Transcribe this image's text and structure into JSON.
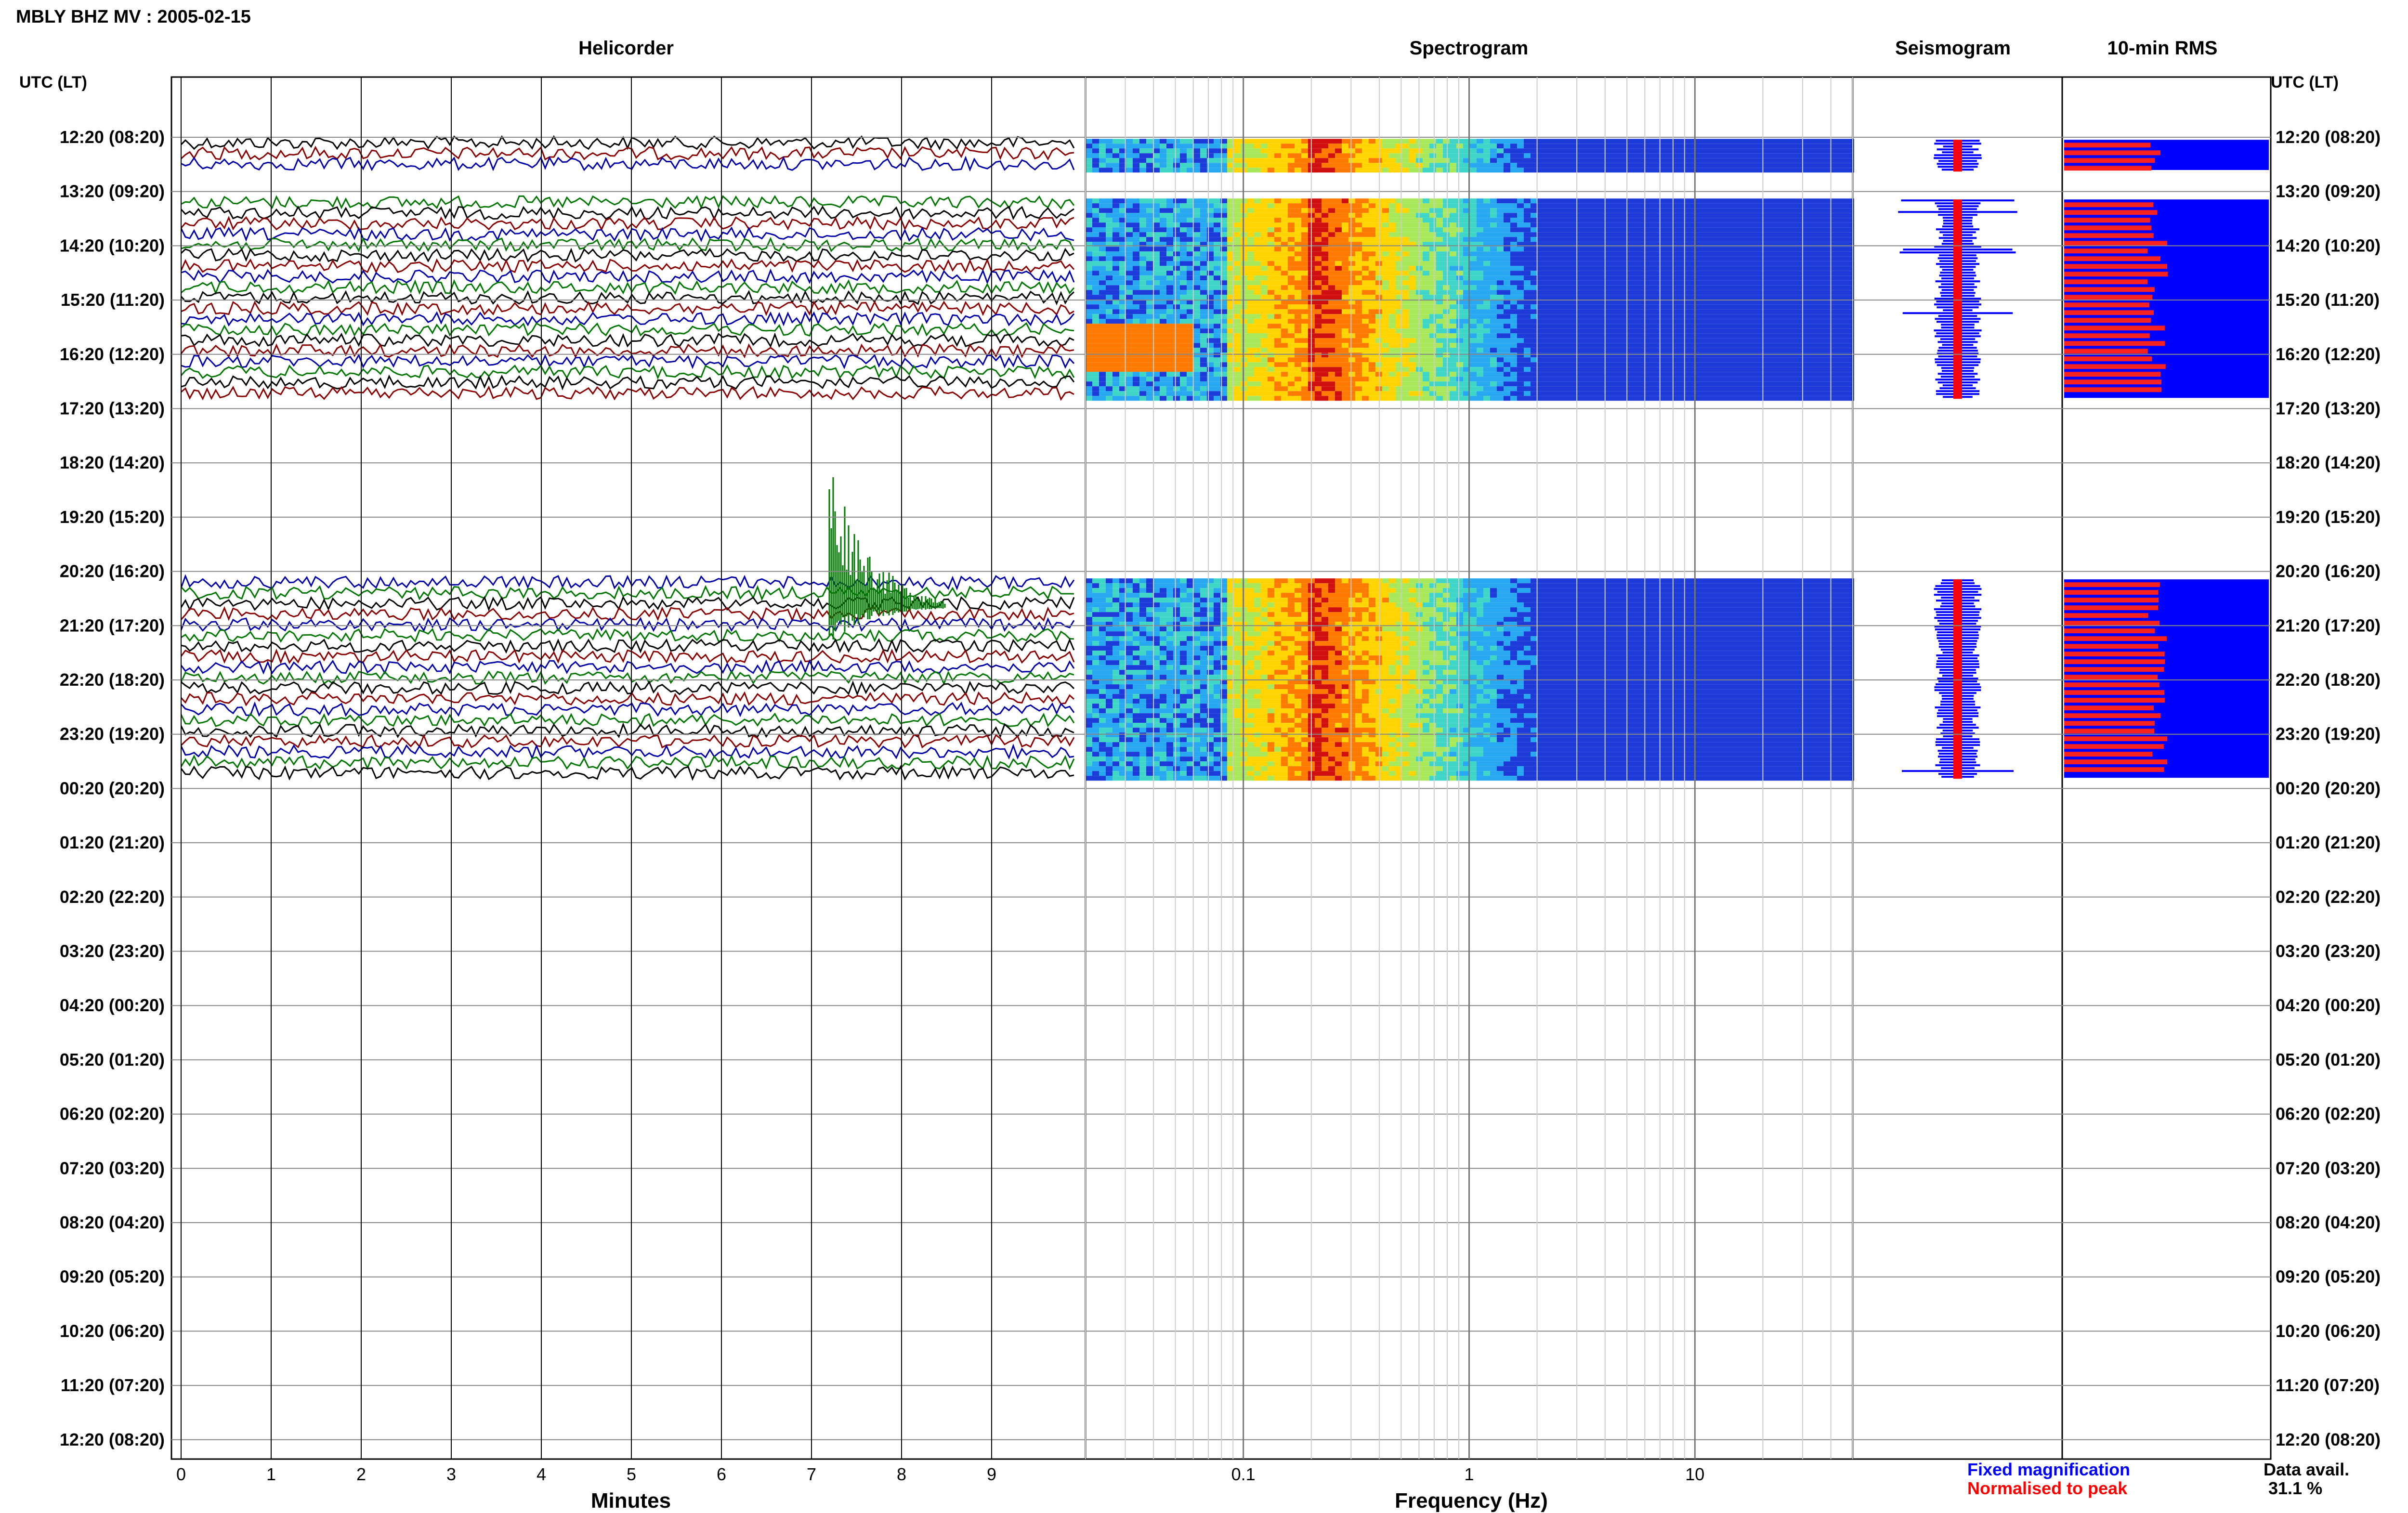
{
  "header": {
    "title": "MBLY BHZ MV : 2005-02-15"
  },
  "panels": {
    "helicorder": "Helicorder",
    "spectrogram": "Spectrogram",
    "seismogram": "Seismogram",
    "rms": "10-min RMS"
  },
  "axes": {
    "time_header_left": "UTC (LT)",
    "time_header_right": "UTC (LT)",
    "time_labels": [
      "12:20 (08:20)",
      "13:20 (09:20)",
      "14:20 (10:20)",
      "15:20 (11:20)",
      "16:20 (12:20)",
      "17:20 (13:20)",
      "18:20 (14:20)",
      "19:20 (15:20)",
      "20:20 (16:20)",
      "21:20 (17:20)",
      "22:20 (18:20)",
      "23:20 (19:20)",
      "00:20 (20:20)",
      "01:20 (21:20)",
      "02:20 (22:20)",
      "03:20 (23:20)",
      "04:20 (00:20)",
      "05:20 (01:20)",
      "06:20 (02:20)",
      "07:20 (03:20)",
      "08:20 (04:20)",
      "09:20 (05:20)",
      "10:20 (06:20)",
      "11:20 (07:20)",
      "12:20 (08:20)"
    ],
    "minutes_label": "Minutes",
    "minutes_ticks": [
      "0",
      "1",
      "2",
      "3",
      "4",
      "5",
      "6",
      "7",
      "8",
      "9"
    ],
    "frequency_label": "Frequency (Hz)",
    "frequency_ticks": [
      "0.1",
      "1",
      "10"
    ]
  },
  "legend": {
    "fixed": "Fixed magnification",
    "normalised": "Normalised to peak",
    "fixed_color": "#0000ff",
    "normalised_color": "#ff0000"
  },
  "availability": {
    "label": "Data avail.",
    "value": "31.1 %"
  },
  "chart_data": {
    "type": "helicorder",
    "rows_hours": 24,
    "data_blocks_hours": [
      [
        0.1,
        0.55
      ],
      [
        1.2,
        4.75
      ],
      [
        8.2,
        11.75
      ]
    ],
    "event": {
      "hour": 8.3,
      "minute_start": 7.2,
      "minute_end": 8.5
    },
    "trace_colors": [
      "#000000",
      "#8b0000",
      "#0000aa",
      "#007700"
    ],
    "frequency_range_hz": [
      0.02,
      50
    ],
    "spectral_peak_hz": 0.2,
    "rms_fill_fraction": 0.45
  }
}
